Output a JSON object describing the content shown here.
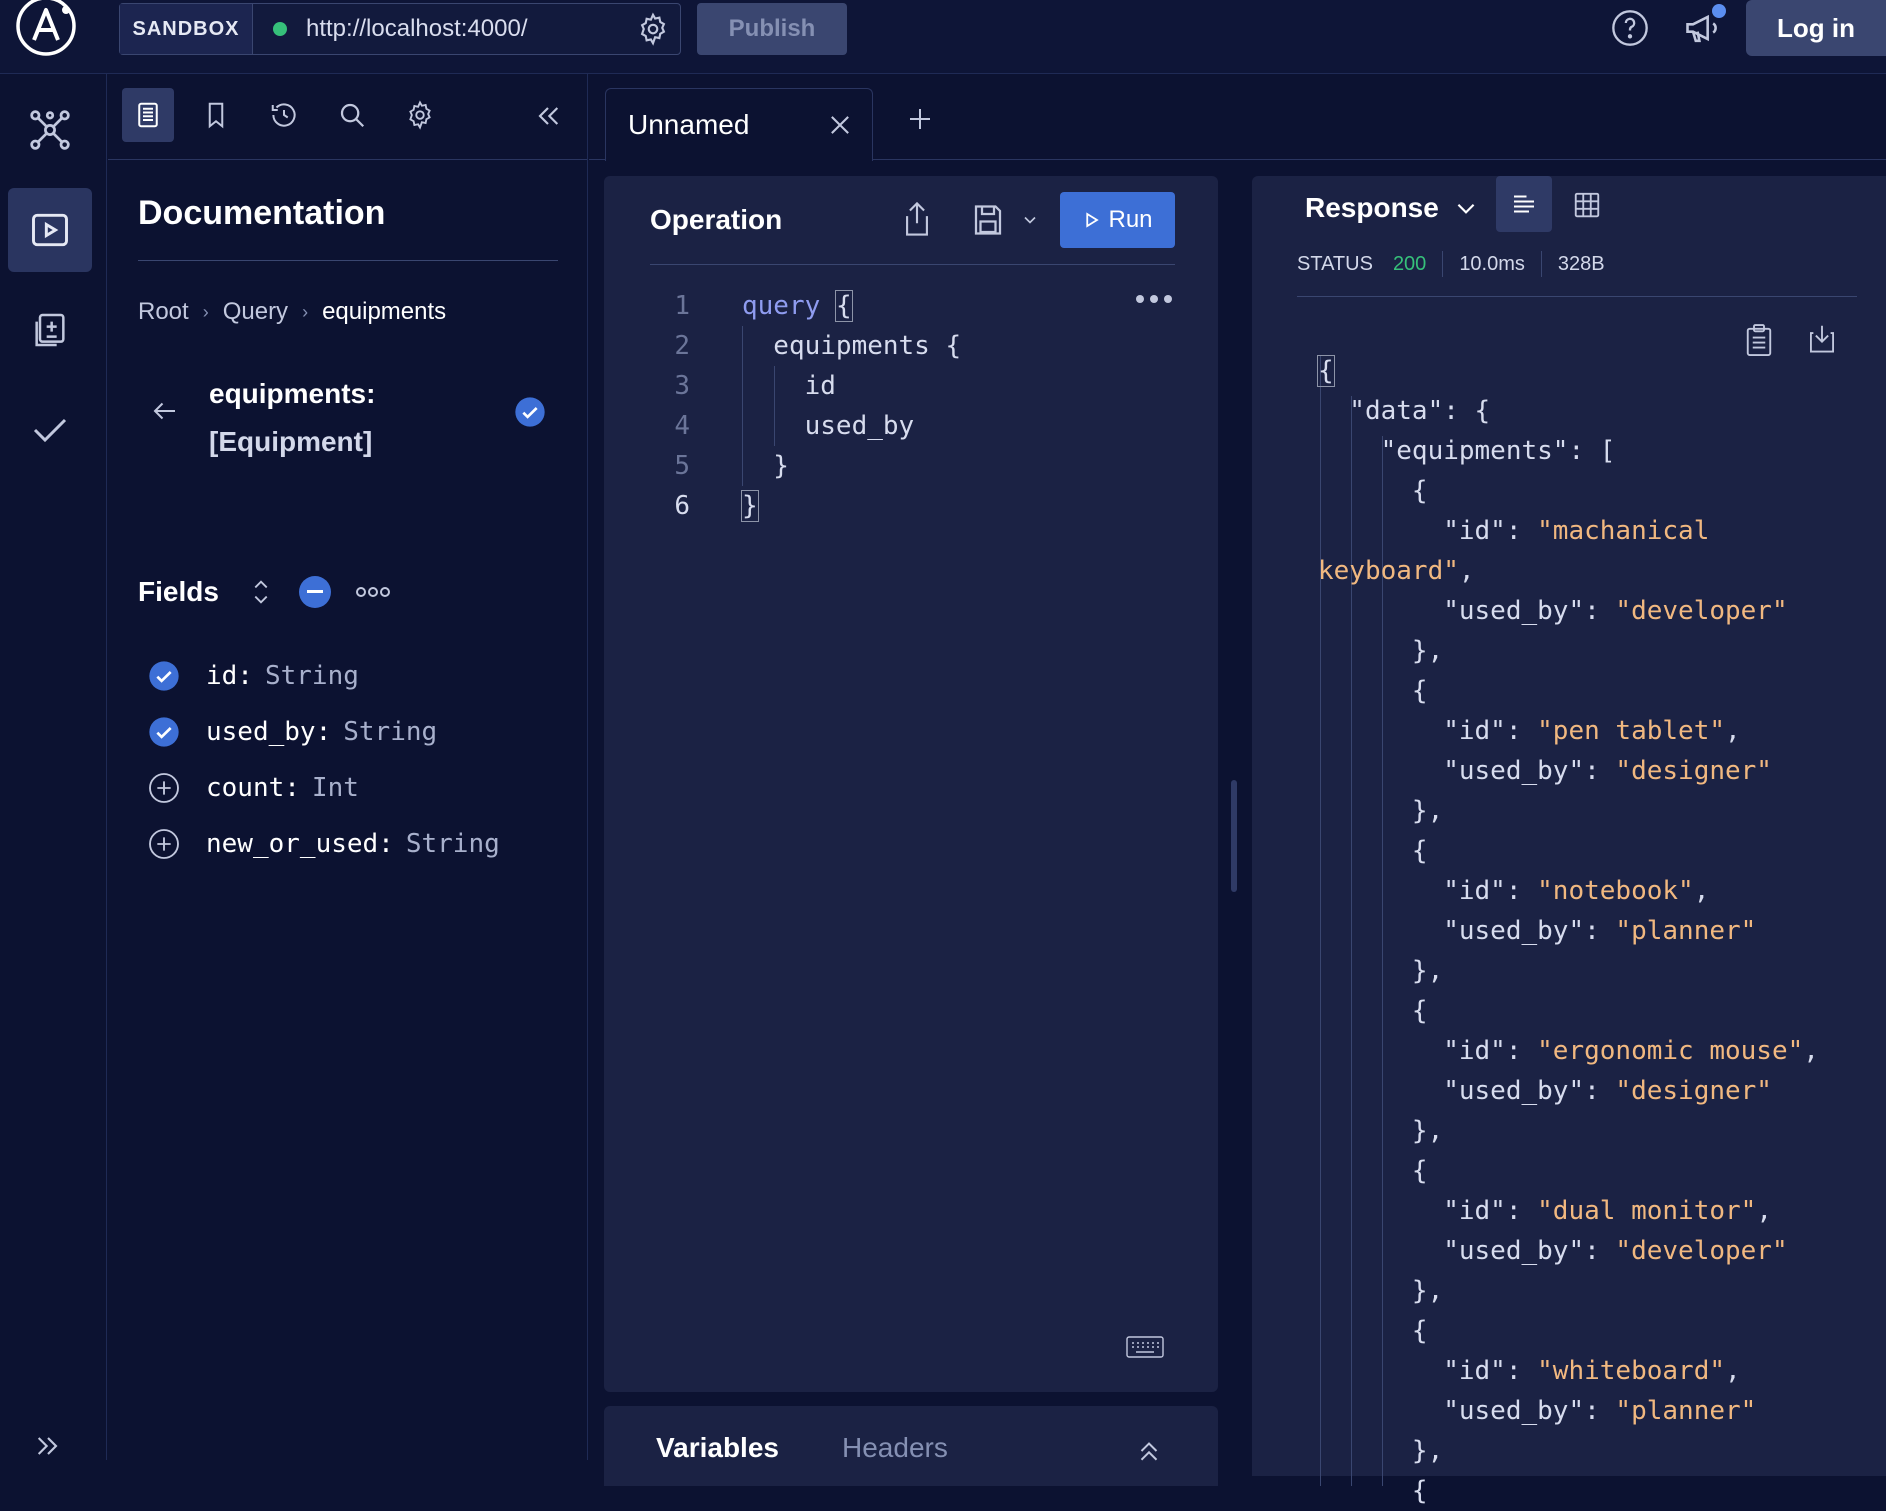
{
  "topbar": {
    "sandbox_label": "SANDBOX",
    "url": "http://localhost:4000/",
    "publish_label": "Publish",
    "login_label": "Log in",
    "url_status_color": "#36c07a"
  },
  "rail": {
    "items": [
      {
        "icon": "graph-icon"
      },
      {
        "icon": "explorer-play-icon",
        "active": true
      },
      {
        "icon": "schema-diff-icon"
      },
      {
        "icon": "checks-icon"
      }
    ]
  },
  "docs": {
    "title": "Documentation",
    "breadcrumb": [
      "Root",
      "Query",
      "equipments"
    ],
    "field_name": "equipments:",
    "field_type": "[Equipment]",
    "fields_label": "Fields",
    "fields": [
      {
        "name": "id:",
        "type": "String",
        "selected": true
      },
      {
        "name": "used_by:",
        "type": "String",
        "selected": true
      },
      {
        "name": "count:",
        "type": "Int",
        "selected": false
      },
      {
        "name": "new_or_used:",
        "type": "String",
        "selected": false
      }
    ]
  },
  "tabs": {
    "items": [
      {
        "label": "Unnamed"
      }
    ]
  },
  "operation": {
    "title": "Operation",
    "run_label": "Run",
    "lines": [
      {
        "n": "1",
        "kw": "query",
        "rest": " {"
      },
      {
        "n": "2",
        "text": "  equipments {"
      },
      {
        "n": "3",
        "text": "    id"
      },
      {
        "n": "4",
        "text": "    used_by"
      },
      {
        "n": "5",
        "text": "  }"
      },
      {
        "n": "6",
        "text": "}"
      }
    ]
  },
  "variables": {
    "variables_label": "Variables",
    "headers_label": "Headers"
  },
  "response": {
    "title": "Response",
    "status_label": "STATUS",
    "status_code": "200",
    "time": "10.0ms",
    "size": "328B",
    "accent": "#3d6fd6",
    "string_color": "#f1b880",
    "items": [
      {
        "id": "machanical keyboard",
        "used_by": "developer"
      },
      {
        "id": "pen tablet",
        "used_by": "designer"
      },
      {
        "id": "notebook",
        "used_by": "planner"
      },
      {
        "id": "ergonomic mouse",
        "used_by": "designer"
      },
      {
        "id": "dual monitor",
        "used_by": "developer"
      },
      {
        "id": "whiteboard",
        "used_by": "planner"
      }
    ]
  }
}
